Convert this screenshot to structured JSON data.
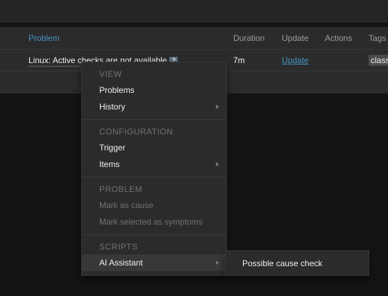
{
  "table": {
    "headers": {
      "problem": "Problem",
      "duration": "Duration",
      "update": "Update",
      "actions": "Actions",
      "tags": "Tags"
    },
    "row": {
      "problem": "Linux: Active checks are not available",
      "help_badge": "?",
      "duration": "7m",
      "update": "Update",
      "tag": "class"
    }
  },
  "context_menu": {
    "view_header": "VIEW",
    "problems": "Problems",
    "history": "History",
    "configuration_header": "CONFIGURATION",
    "trigger": "Trigger",
    "items": "Items",
    "problem_header": "PROBLEM",
    "mark_as_cause": "Mark as cause",
    "mark_selected_as_symptoms": "Mark selected as symptoms",
    "scripts_header": "SCRIPTS",
    "ai_assistant": "AI Assistant"
  },
  "submenu": {
    "possible_cause_check": "Possible cause check"
  },
  "colors": {
    "link": "#4796c4",
    "background": "#141414",
    "panel": "#2b2b2b"
  }
}
